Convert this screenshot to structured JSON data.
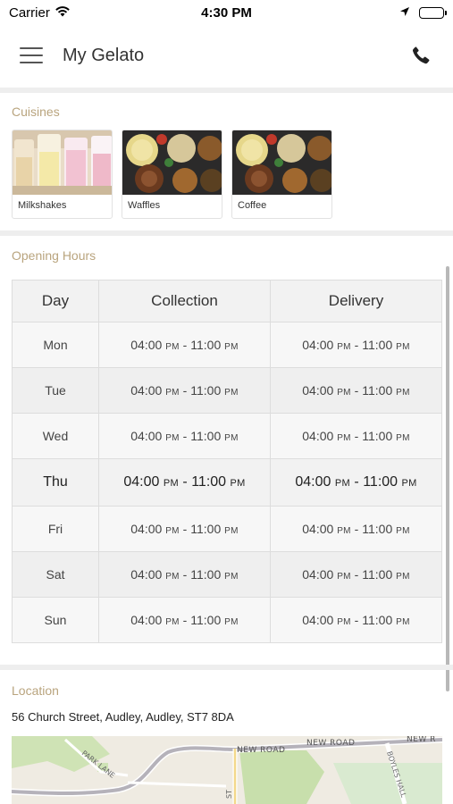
{
  "status_bar": {
    "carrier": "Carrier",
    "time": "4:30 PM"
  },
  "app_bar": {
    "title": "My Gelato"
  },
  "cuisines": {
    "heading": "Cuisines",
    "items": [
      {
        "label": "Milkshakes"
      },
      {
        "label": "Waffles"
      },
      {
        "label": "Coffee"
      }
    ]
  },
  "opening_hours": {
    "heading": "Opening Hours",
    "columns": [
      "Day",
      "Collection",
      "Delivery"
    ],
    "rows": [
      {
        "day": "Mon",
        "collection": {
          "open": "04:00",
          "open_period": "PM",
          "close": "11:00",
          "close_period": "PM"
        },
        "delivery": {
          "open": "04:00",
          "open_period": "PM",
          "close": "11:00",
          "close_period": "PM"
        }
      },
      {
        "day": "Tue",
        "collection": {
          "open": "04:00",
          "open_period": "PM",
          "close": "11:00",
          "close_period": "PM"
        },
        "delivery": {
          "open": "04:00",
          "open_period": "PM",
          "close": "11:00",
          "close_period": "PM"
        }
      },
      {
        "day": "Wed",
        "collection": {
          "open": "04:00",
          "open_period": "PM",
          "close": "11:00",
          "close_period": "PM"
        },
        "delivery": {
          "open": "04:00",
          "open_period": "PM",
          "close": "11:00",
          "close_period": "PM"
        }
      },
      {
        "day": "Thu",
        "collection": {
          "open": "04:00",
          "open_period": "PM",
          "close": "11:00",
          "close_period": "PM"
        },
        "delivery": {
          "open": "04:00",
          "open_period": "PM",
          "close": "11:00",
          "close_period": "PM"
        }
      },
      {
        "day": "Fri",
        "collection": {
          "open": "04:00",
          "open_period": "PM",
          "close": "11:00",
          "close_period": "PM"
        },
        "delivery": {
          "open": "04:00",
          "open_period": "PM",
          "close": "11:00",
          "close_period": "PM"
        }
      },
      {
        "day": "Sat",
        "collection": {
          "open": "04:00",
          "open_period": "PM",
          "close": "11:00",
          "close_period": "PM"
        },
        "delivery": {
          "open": "04:00",
          "open_period": "PM",
          "close": "11:00",
          "close_period": "PM"
        }
      },
      {
        "day": "Sun",
        "collection": {
          "open": "04:00",
          "open_period": "PM",
          "close": "11:00",
          "close_period": "PM"
        },
        "delivery": {
          "open": "04:00",
          "open_period": "PM",
          "close": "11:00",
          "close_period": "PM"
        }
      }
    ]
  },
  "location": {
    "heading": "Location",
    "address": "56 Church Street, Audley, Audley, ST7 8DA",
    "map": {
      "road_labels": [
        "NEW ROAD",
        "NEW ROAD",
        "NEW R",
        "PARK LANE",
        "BOYLES HALL",
        "ST"
      ]
    }
  },
  "icons": {
    "wifi": "wifi-icon",
    "location_arrow": "location-arrow-icon",
    "battery": "battery-icon",
    "menu": "hamburger-menu-icon",
    "phone": "phone-icon"
  },
  "colors": {
    "section_heading": "#b9a47e",
    "divider": "#eeeeee",
    "table_border": "#dddddd",
    "map_green": "#cfe3b5",
    "map_land": "#efebe2"
  }
}
